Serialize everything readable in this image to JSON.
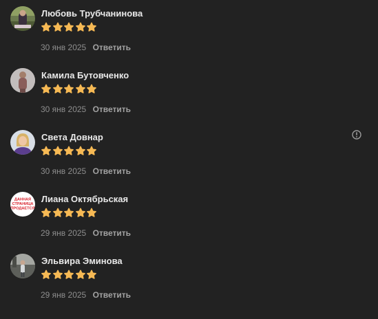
{
  "reviews": [
    {
      "author": "Любовь Трубчанинова",
      "rating": 5,
      "date": "30 янв 2025",
      "reply_label": "Ответить",
      "avatar": "photo-outdoor"
    },
    {
      "author": "Камила Бутовченко",
      "rating": 5,
      "date": "30 янв 2025",
      "reply_label": "Ответить",
      "avatar": "photo-person"
    },
    {
      "author": "Света Довнар",
      "rating": 5,
      "date": "30 янв 2025",
      "reply_label": "Ответить",
      "avatar": "photo-portrait",
      "has_info": true
    },
    {
      "author": "Лиана Октябрьская",
      "rating": 5,
      "date": "29 янв 2025",
      "reply_label": "Ответить",
      "avatar": "text-badge",
      "avatar_text": [
        "ДАННАЯ",
        "СТРАНИЦА",
        "ПРОДАЕТСЯ"
      ]
    },
    {
      "author": "Эльвира Эминова",
      "rating": 5,
      "date": "29 янв 2025",
      "reply_label": "Ответить",
      "avatar": "photo-street"
    }
  ],
  "icons": {
    "star": "star-icon",
    "info": "info-circle-icon"
  },
  "colors": {
    "background": "#222222",
    "star": "#f6b954",
    "author": "#e9e9e9",
    "date": "#8e8e8e",
    "reply": "#a2a2a2",
    "badge_text": "#d8202a"
  }
}
